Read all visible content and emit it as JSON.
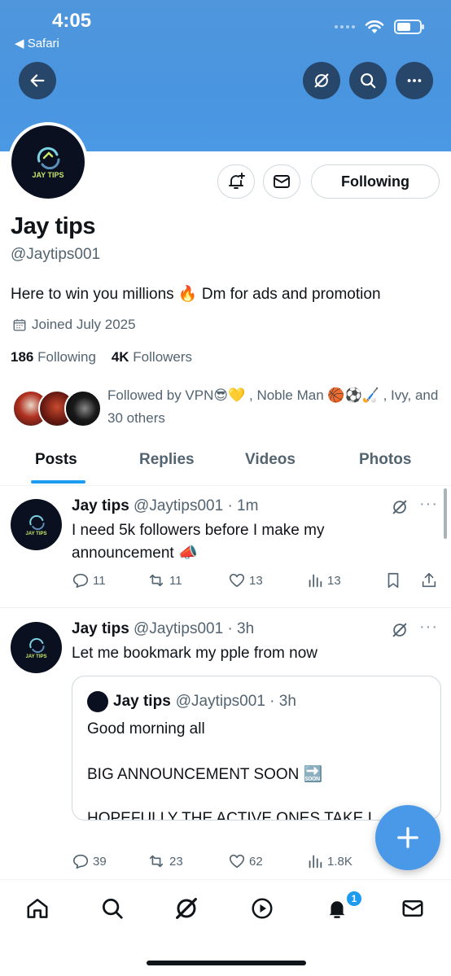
{
  "status_bar": {
    "time": "4:05",
    "back_app": "◀ Safari"
  },
  "profile": {
    "avatar_text": "JAY TIPS",
    "name": "Jay tips",
    "handle": "@Jaytips001",
    "bio": "Here to win you millions 🔥 Dm for ads and promotion",
    "joined": "Joined July 2025",
    "following_count": "186",
    "following_label": "Following",
    "followers_count": "4K",
    "followers_label": "Followers",
    "followed_by": "Followed by VPN😎💛 , Noble Man 🏀⚽🏑 , Ivy, and 30 others",
    "following_button": "Following"
  },
  "tabs": [
    "Posts",
    "Replies",
    "Videos",
    "Photos"
  ],
  "posts": [
    {
      "name": "Jay tips",
      "meta": "@Jaytips001 · 1m",
      "text": "I need 5k followers before I make my announcement 📣",
      "replies": "11",
      "reposts": "11",
      "likes": "13",
      "views": "13"
    },
    {
      "name": "Jay tips",
      "meta": "@Jaytips001 · 3h",
      "text": "Let me bookmark my pple from now",
      "replies": "39",
      "reposts": "23",
      "likes": "62",
      "views": "1.8K",
      "quote": {
        "name": "Jay tips",
        "meta": "@Jaytips001 · 3h",
        "line1": "Good morning all",
        "line2": "BIG ANNOUNCEMENT SOON 🔜",
        "line3": "HOPEFULLY THE ACTIVE ONES TAKE I"
      }
    }
  ],
  "avatar_small_text": "JAY TIPS",
  "nav": {
    "notifications_badge": "1"
  },
  "colors": {
    "accent": "#1d9bf0",
    "banner": "#4f96dc",
    "text": "#0f1419",
    "secondary": "#536471"
  },
  "icons": [
    "back-arrow-icon",
    "grok-icon",
    "search-icon",
    "more-icon",
    "notification-add-icon",
    "mail-icon",
    "calendar-icon",
    "reply-icon",
    "repost-icon",
    "like-icon",
    "views-icon",
    "bookmark-icon",
    "share-icon",
    "home-icon",
    "play-icon",
    "bell-icon",
    "plus-icon"
  ]
}
